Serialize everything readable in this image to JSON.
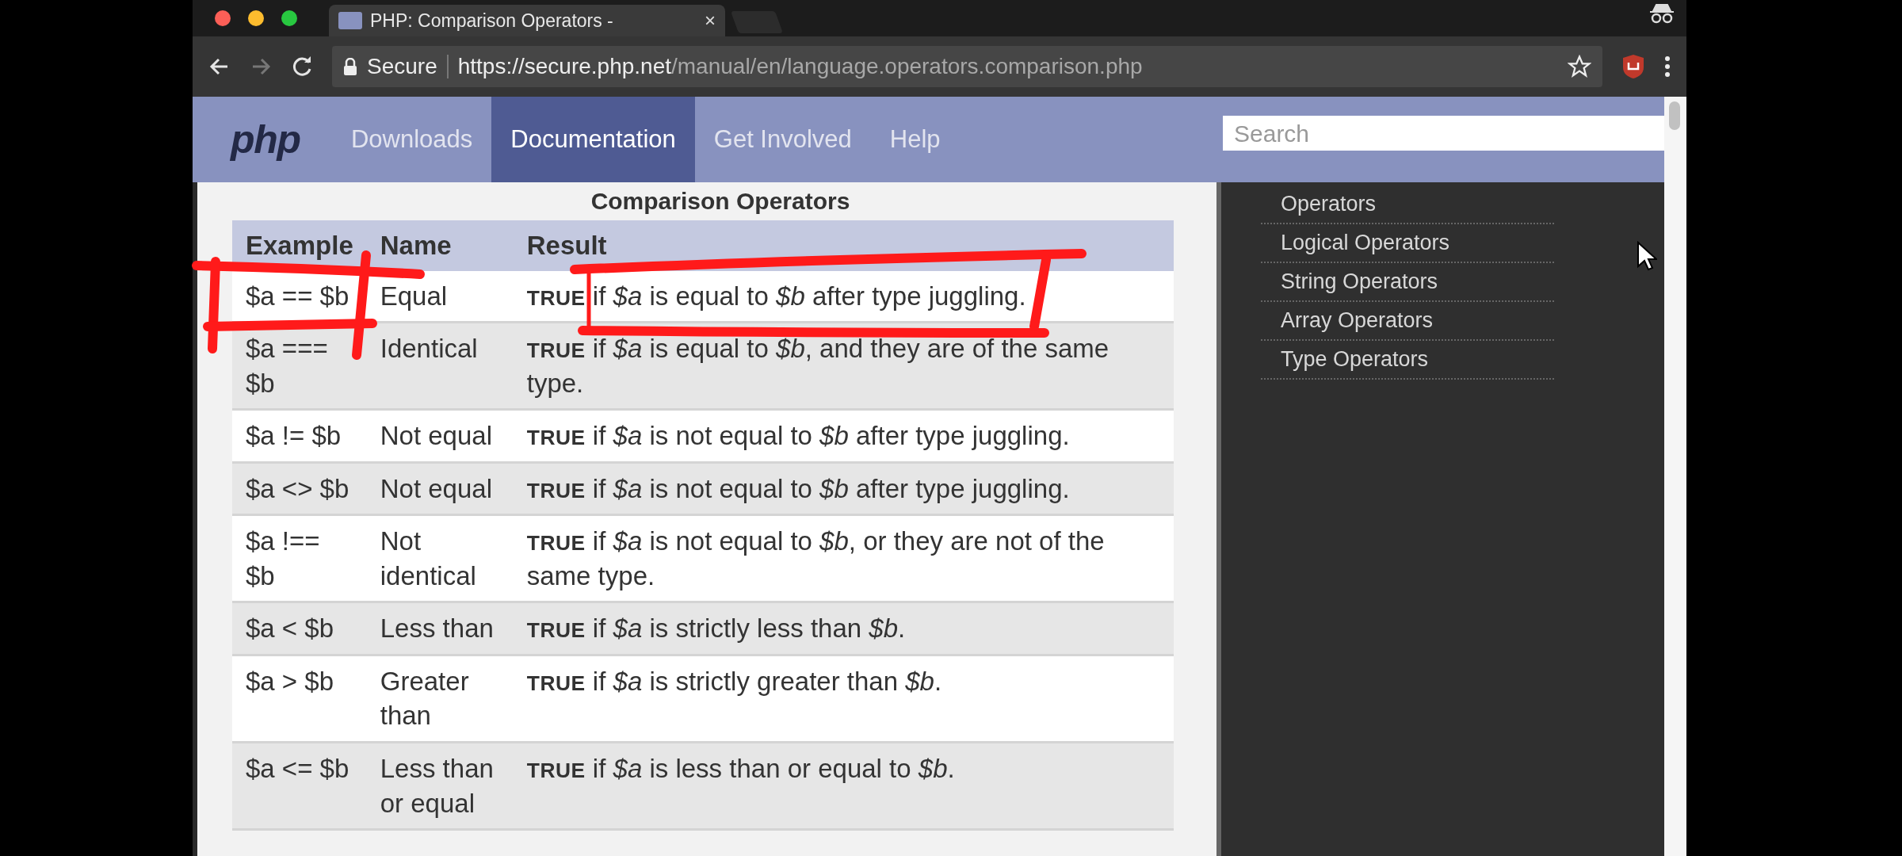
{
  "browser": {
    "tab_title": "PHP: Comparison Operators -",
    "tab_close": "×",
    "secure_label": "Secure",
    "url_host": "https://secure.php.net",
    "url_path": "/manual/en/language.operators.comparison.php"
  },
  "nav": {
    "logo": "php",
    "items": [
      {
        "label": "Downloads",
        "selected": false
      },
      {
        "label": "Documentation",
        "selected": true
      },
      {
        "label": "Get Involved",
        "selected": false
      },
      {
        "label": "Help",
        "selected": false
      }
    ],
    "search": {
      "placeholder": "Search"
    }
  },
  "table": {
    "caption": "Comparison Operators",
    "columns": [
      "Example",
      "Name",
      "Result"
    ],
    "rows": [
      {
        "example": "$a == $b",
        "name": "Equal",
        "result": "**TRUE** if *$a* is equal to *$b* after type juggling."
      },
      {
        "example": "$a === $b",
        "name": "Identical",
        "result": "**TRUE** if *$a* is equal to *$b*, and they are of the same type."
      },
      {
        "example": "$a != $b",
        "name": "Not equal",
        "result": "**TRUE** if *$a* is not equal to *$b* after type juggling."
      },
      {
        "example": "$a <> $b",
        "name": "Not equal",
        "result": "**TRUE** if *$a* is not equal to *$b* after type juggling."
      },
      {
        "example": "$a !== $b",
        "name": "Not identical",
        "result": "**TRUE** if *$a* is not equal to *$b*, or they are not of the same type."
      },
      {
        "example": "$a < $b",
        "name": "Less than",
        "result": "**TRUE** if *$a* is strictly less than *$b*."
      },
      {
        "example": "$a > $b",
        "name": "Greater than",
        "result": "**TRUE** if *$a* is strictly greater than *$b*."
      },
      {
        "example": "$a <= $b",
        "name": "Less than or equal",
        "result": "**TRUE** if *$a* is less than or equal to *$b*."
      }
    ]
  },
  "sidebar": {
    "items": [
      "Operators",
      "Logical Operators",
      "String Operators",
      "Array Operators",
      "Type Operators"
    ]
  }
}
